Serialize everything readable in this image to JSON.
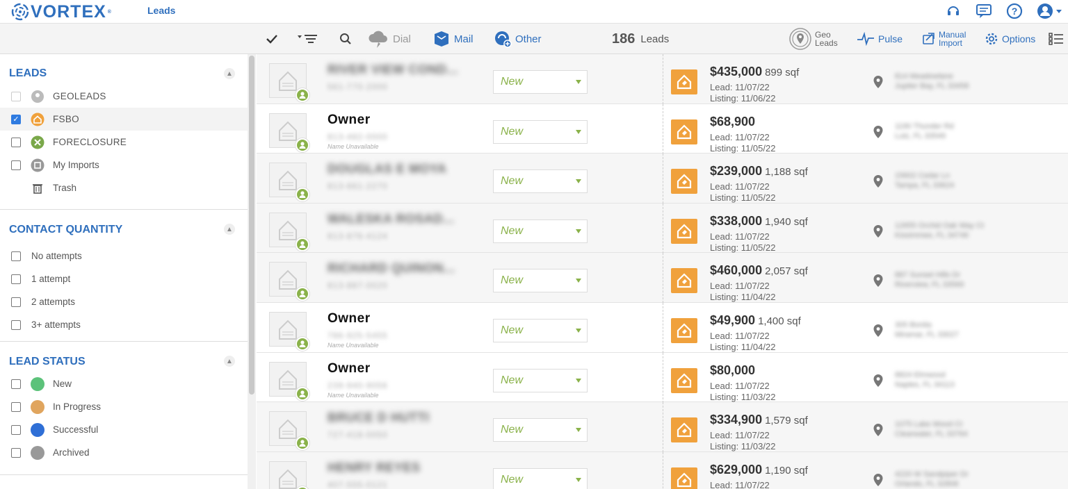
{
  "header": {
    "logo": "VORTEX",
    "logo_mark": "®",
    "nav_leads": "Leads"
  },
  "toolbar": {
    "dial": "Dial",
    "mail": "Mail",
    "other": "Other",
    "lead_count": "186",
    "lead_count_label": "Leads",
    "geo_line1": "Geo",
    "geo_line2": "Leads",
    "pulse": "Pulse",
    "manual_line1": "Manual",
    "manual_line2": "Import",
    "options": "Options"
  },
  "sidebar": {
    "leads": {
      "title": "LEADS",
      "items": [
        {
          "label": "GEOLEADS",
          "checked": false,
          "dim": true
        },
        {
          "label": "FSBO",
          "checked": true
        },
        {
          "label": "FORECLOSURE",
          "checked": false
        },
        {
          "label": "My Imports",
          "checked": false
        },
        {
          "label": "Trash",
          "checked": false
        }
      ]
    },
    "contact_quantity": {
      "title": "CONTACT QUANTITY",
      "items": [
        "No attempts",
        "1 attempt",
        "2 attempts",
        "3+ attempts"
      ]
    },
    "lead_status": {
      "title": "LEAD STATUS",
      "items": [
        {
          "label": "New",
          "color": "#5cc27a"
        },
        {
          "label": "In Progress",
          "color": "#e0a55e"
        },
        {
          "label": "Successful",
          "color": "#2f6fd6"
        },
        {
          "label": "Archived",
          "color": "#999999"
        }
      ]
    }
  },
  "leads": [
    {
      "name": "RIVER VIEW COND...",
      "blurred": true,
      "phone": "561-770-2000",
      "status": "New",
      "price": "$435,000",
      "sqf": "899 sqf",
      "lead_date": "Lead: 11/07/22",
      "listing_date": "Listing: 11/06/22",
      "address1": "814 Meadowlane",
      "address2": "Jupiter Bay, FL 33458"
    },
    {
      "name": "Owner",
      "blurred": false,
      "phone": "813-482-0000",
      "name_unavailable": "Name Unavailable",
      "status": "New",
      "price": "$68,900",
      "sqf": "",
      "lead_date": "Lead: 11/07/22",
      "listing_date": "Listing: 11/05/22",
      "address1": "1190 Thunder Rd",
      "address2": "Lutz, FL 33549"
    },
    {
      "name": "DOUGLAS E MOYA",
      "blurred": true,
      "phone": "813-661-2270",
      "status": "New",
      "price": "$239,000",
      "sqf": "1,188 sqf",
      "lead_date": "Lead: 11/07/22",
      "listing_date": "Listing: 11/05/22",
      "address1": "15602 Cedar Ln",
      "address2": "Tampa, FL 33624"
    },
    {
      "name": "WALESKA ROSAD...",
      "blurred": true,
      "phone": "813-876-4124",
      "status": "New",
      "price": "$338,000",
      "sqf": "1,940 sqf",
      "lead_date": "Lead: 11/07/22",
      "listing_date": "Listing: 11/05/22",
      "address1": "12655 Orchid Oak Way Ct",
      "address2": "Kissimmee, FL 34746"
    },
    {
      "name": "RICHARD QUINON...",
      "blurred": true,
      "phone": "813-887-0020",
      "status": "New",
      "price": "$460,000",
      "sqf": "2,057 sqf",
      "lead_date": "Lead: 11/07/22",
      "listing_date": "Listing: 11/04/22",
      "address1": "887 Sunset Hills Dr",
      "address2": "Riverview, FL 33569"
    },
    {
      "name": "Owner",
      "blurred": false,
      "phone": "786-925-5455",
      "name_unavailable": "Name Unavailable",
      "status": "New",
      "price": "$49,900",
      "sqf": "1,400 sqf",
      "lead_date": "Lead: 11/07/22",
      "listing_date": "Listing: 11/04/22",
      "address1": "305 Bonita",
      "address2": "Miramar, FL 33027"
    },
    {
      "name": "Owner",
      "blurred": false,
      "phone": "239-940-9056",
      "name_unavailable": "Name Unavailable",
      "status": "New",
      "price": "$80,000",
      "sqf": "",
      "lead_date": "Lead: 11/07/22",
      "listing_date": "Listing: 11/03/22",
      "address1": "8824 Elmwood",
      "address2": "Naples, FL 34113"
    },
    {
      "name": "BRUCE D HUTTI",
      "blurred": true,
      "phone": "727-418-0050",
      "status": "New",
      "price": "$334,900",
      "sqf": "1,579 sqf",
      "lead_date": "Lead: 11/07/22",
      "listing_date": "Listing: 11/03/22",
      "address1": "1075 Lake Wood Ct",
      "address2": "Clearwater, FL 33764"
    },
    {
      "name": "HENRY REYES",
      "blurred": true,
      "phone": "407-555-0121",
      "status": "New",
      "price": "$629,000",
      "sqf": "1,190 sqf",
      "lead_date": "Lead: 11/07/22",
      "listing_date": "",
      "address1": "4220 W Sandpiper Dr",
      "address2": "Orlando, FL 32808"
    }
  ],
  "colors": {
    "brand": "#2f6fbd",
    "badge": "#f0a13c",
    "status_text": "#8ab24a"
  }
}
